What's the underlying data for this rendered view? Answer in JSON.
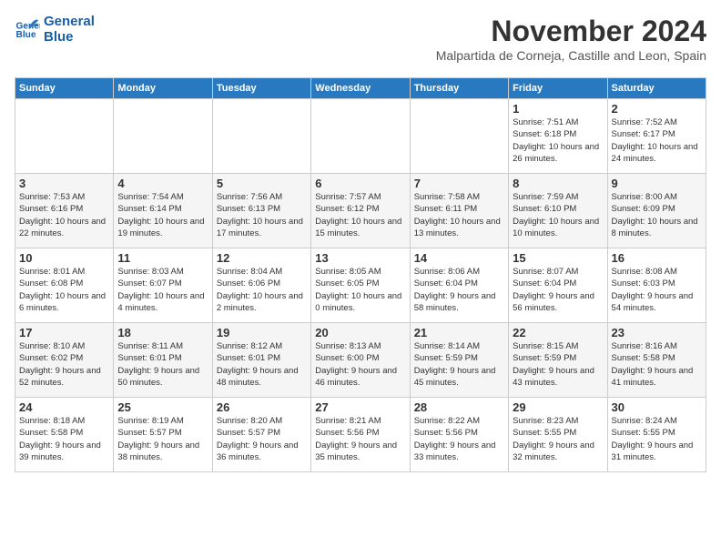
{
  "logo": {
    "line1": "General",
    "line2": "Blue"
  },
  "title": "November 2024",
  "subtitle": "Malpartida de Corneja, Castille and Leon, Spain",
  "headers": [
    "Sunday",
    "Monday",
    "Tuesday",
    "Wednesday",
    "Thursday",
    "Friday",
    "Saturday"
  ],
  "weeks": [
    [
      {
        "day": "",
        "info": ""
      },
      {
        "day": "",
        "info": ""
      },
      {
        "day": "",
        "info": ""
      },
      {
        "day": "",
        "info": ""
      },
      {
        "day": "",
        "info": ""
      },
      {
        "day": "1",
        "info": "Sunrise: 7:51 AM\nSunset: 6:18 PM\nDaylight: 10 hours and 26 minutes."
      },
      {
        "day": "2",
        "info": "Sunrise: 7:52 AM\nSunset: 6:17 PM\nDaylight: 10 hours and 24 minutes."
      }
    ],
    [
      {
        "day": "3",
        "info": "Sunrise: 7:53 AM\nSunset: 6:16 PM\nDaylight: 10 hours and 22 minutes."
      },
      {
        "day": "4",
        "info": "Sunrise: 7:54 AM\nSunset: 6:14 PM\nDaylight: 10 hours and 19 minutes."
      },
      {
        "day": "5",
        "info": "Sunrise: 7:56 AM\nSunset: 6:13 PM\nDaylight: 10 hours and 17 minutes."
      },
      {
        "day": "6",
        "info": "Sunrise: 7:57 AM\nSunset: 6:12 PM\nDaylight: 10 hours and 15 minutes."
      },
      {
        "day": "7",
        "info": "Sunrise: 7:58 AM\nSunset: 6:11 PM\nDaylight: 10 hours and 13 minutes."
      },
      {
        "day": "8",
        "info": "Sunrise: 7:59 AM\nSunset: 6:10 PM\nDaylight: 10 hours and 10 minutes."
      },
      {
        "day": "9",
        "info": "Sunrise: 8:00 AM\nSunset: 6:09 PM\nDaylight: 10 hours and 8 minutes."
      }
    ],
    [
      {
        "day": "10",
        "info": "Sunrise: 8:01 AM\nSunset: 6:08 PM\nDaylight: 10 hours and 6 minutes."
      },
      {
        "day": "11",
        "info": "Sunrise: 8:03 AM\nSunset: 6:07 PM\nDaylight: 10 hours and 4 minutes."
      },
      {
        "day": "12",
        "info": "Sunrise: 8:04 AM\nSunset: 6:06 PM\nDaylight: 10 hours and 2 minutes."
      },
      {
        "day": "13",
        "info": "Sunrise: 8:05 AM\nSunset: 6:05 PM\nDaylight: 10 hours and 0 minutes."
      },
      {
        "day": "14",
        "info": "Sunrise: 8:06 AM\nSunset: 6:04 PM\nDaylight: 9 hours and 58 minutes."
      },
      {
        "day": "15",
        "info": "Sunrise: 8:07 AM\nSunset: 6:04 PM\nDaylight: 9 hours and 56 minutes."
      },
      {
        "day": "16",
        "info": "Sunrise: 8:08 AM\nSunset: 6:03 PM\nDaylight: 9 hours and 54 minutes."
      }
    ],
    [
      {
        "day": "17",
        "info": "Sunrise: 8:10 AM\nSunset: 6:02 PM\nDaylight: 9 hours and 52 minutes."
      },
      {
        "day": "18",
        "info": "Sunrise: 8:11 AM\nSunset: 6:01 PM\nDaylight: 9 hours and 50 minutes."
      },
      {
        "day": "19",
        "info": "Sunrise: 8:12 AM\nSunset: 6:01 PM\nDaylight: 9 hours and 48 minutes."
      },
      {
        "day": "20",
        "info": "Sunrise: 8:13 AM\nSunset: 6:00 PM\nDaylight: 9 hours and 46 minutes."
      },
      {
        "day": "21",
        "info": "Sunrise: 8:14 AM\nSunset: 5:59 PM\nDaylight: 9 hours and 45 minutes."
      },
      {
        "day": "22",
        "info": "Sunrise: 8:15 AM\nSunset: 5:59 PM\nDaylight: 9 hours and 43 minutes."
      },
      {
        "day": "23",
        "info": "Sunrise: 8:16 AM\nSunset: 5:58 PM\nDaylight: 9 hours and 41 minutes."
      }
    ],
    [
      {
        "day": "24",
        "info": "Sunrise: 8:18 AM\nSunset: 5:58 PM\nDaylight: 9 hours and 39 minutes."
      },
      {
        "day": "25",
        "info": "Sunrise: 8:19 AM\nSunset: 5:57 PM\nDaylight: 9 hours and 38 minutes."
      },
      {
        "day": "26",
        "info": "Sunrise: 8:20 AM\nSunset: 5:57 PM\nDaylight: 9 hours and 36 minutes."
      },
      {
        "day": "27",
        "info": "Sunrise: 8:21 AM\nSunset: 5:56 PM\nDaylight: 9 hours and 35 minutes."
      },
      {
        "day": "28",
        "info": "Sunrise: 8:22 AM\nSunset: 5:56 PM\nDaylight: 9 hours and 33 minutes."
      },
      {
        "day": "29",
        "info": "Sunrise: 8:23 AM\nSunset: 5:55 PM\nDaylight: 9 hours and 32 minutes."
      },
      {
        "day": "30",
        "info": "Sunrise: 8:24 AM\nSunset: 5:55 PM\nDaylight: 9 hours and 31 minutes."
      }
    ]
  ]
}
